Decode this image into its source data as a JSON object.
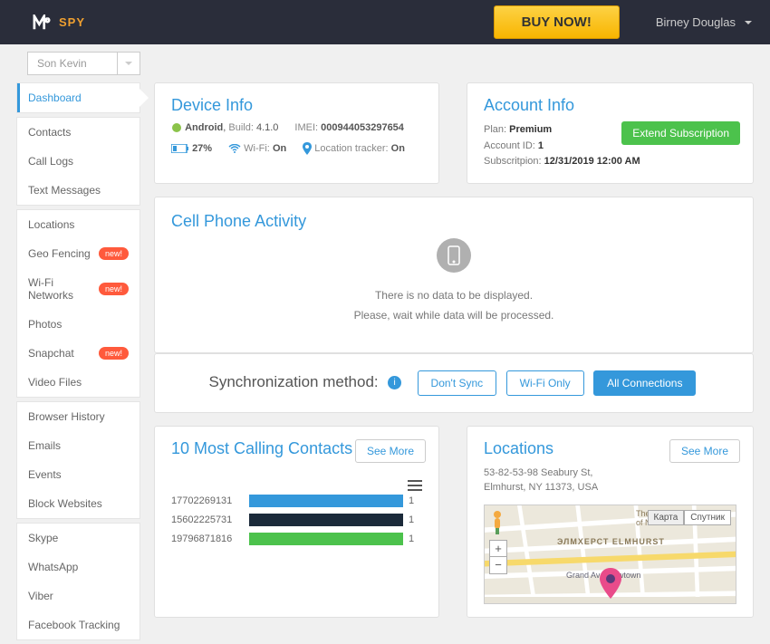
{
  "header": {
    "brand": "SPY",
    "buy_label": "BUY NOW!",
    "user_name": "Birney Douglas"
  },
  "device_selector": "Son Kevin",
  "sidebar": {
    "g1": [
      {
        "label": "Dashboard",
        "active": true
      }
    ],
    "g2": [
      {
        "label": "Contacts"
      },
      {
        "label": "Call Logs"
      },
      {
        "label": "Text Messages"
      }
    ],
    "g3": [
      {
        "label": "Locations"
      },
      {
        "label": "Geo Fencing",
        "badge": "new!"
      },
      {
        "label": "Wi-Fi Networks",
        "badge": "new!"
      },
      {
        "label": "Photos"
      },
      {
        "label": "Snapchat",
        "badge": "new!"
      },
      {
        "label": "Video Files"
      }
    ],
    "g4": [
      {
        "label": "Browser History"
      },
      {
        "label": "Emails"
      },
      {
        "label": "Events"
      },
      {
        "label": "Block Websites"
      }
    ],
    "g5": [
      {
        "label": "Skype"
      },
      {
        "label": "WhatsApp"
      },
      {
        "label": "Viber"
      },
      {
        "label": "Facebook Tracking"
      }
    ]
  },
  "device_info": {
    "title": "Device Info",
    "os": "Android",
    "build_label": "Build:",
    "build": "4.1.0",
    "imei_label": "IMEI:",
    "imei": "000944053297654",
    "battery": "27%",
    "wifi_label": "Wi-Fi:",
    "wifi": "On",
    "loc_label": "Location tracker:",
    "loc": "On"
  },
  "account_info": {
    "title": "Account Info",
    "plan_label": "Plan:",
    "plan": "Premium",
    "acct_label": "Account ID:",
    "acct": "1",
    "sub_label": "Subscritpion:",
    "sub": "12/31/2019 12:00 AM",
    "extend": "Extend Subscription"
  },
  "activity": {
    "title": "Cell Phone Activity",
    "line1": "There is no data to be displayed.",
    "line2": "Please, wait while data will be processed."
  },
  "sync": {
    "label": "Synchronization method:",
    "b1": "Don't Sync",
    "b2": "Wi-Fi Only",
    "b3": "All Connections"
  },
  "contacts": {
    "title": "10 Most Calling Contacts",
    "see_more": "See More"
  },
  "locations": {
    "title": "Locations",
    "addr1": "53-82-53-98 Seabury St,",
    "addr2": "Elmhurst, NY 11373, USA",
    "see_more": "See More",
    "map_type_1": "Карта",
    "map_type_2": "Спутник",
    "poi1": "The Reformed Church of Newtown",
    "poi2": "ЭЛМХЕРСТ ELMHURST",
    "poi3": "Grand Av - Newtown"
  },
  "chart_data": {
    "type": "bar",
    "orientation": "horizontal",
    "categories": [
      "17702269131",
      "15602225731",
      "19796871816"
    ],
    "values": [
      1,
      1,
      1
    ],
    "colors": [
      "#3498db",
      "#1b2a3a",
      "#4cc24c"
    ],
    "title": "10 Most Calling Contacts"
  }
}
